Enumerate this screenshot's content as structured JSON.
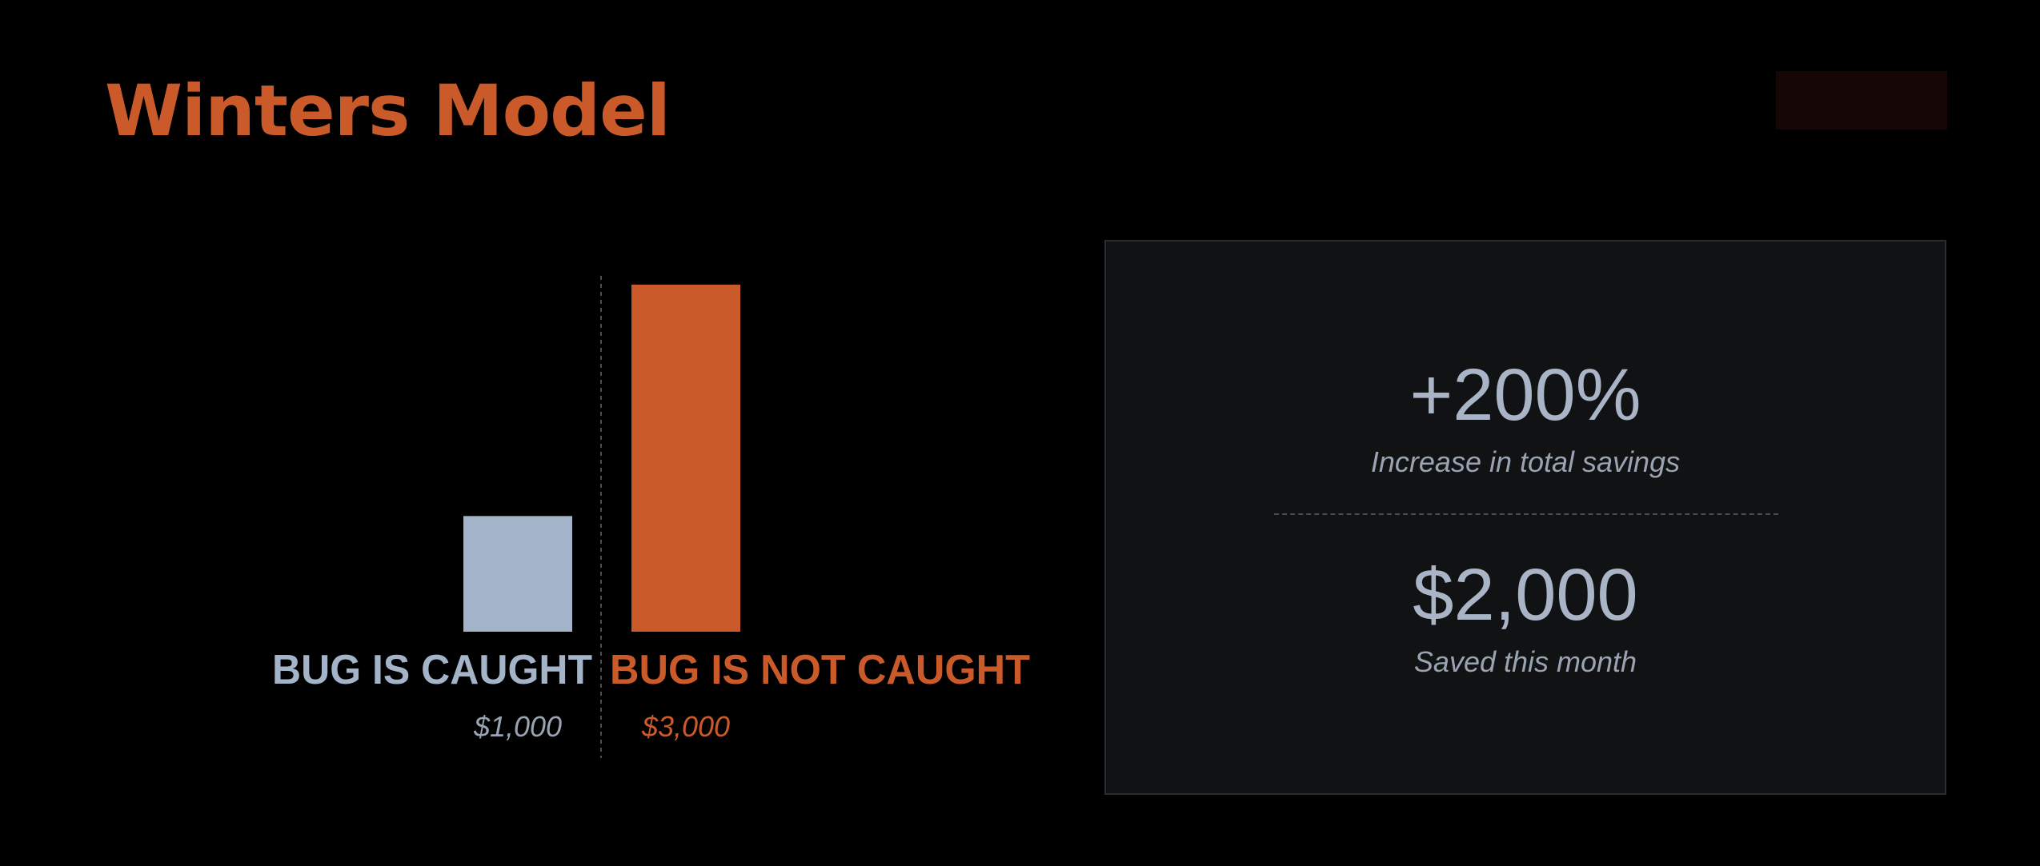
{
  "title": "Winters Model",
  "colors": {
    "background": "#000000",
    "accent": "#cb5a2a",
    "muted": "#a3b3c8",
    "panel": "#111213"
  },
  "chart_data": {
    "type": "bar",
    "title": "",
    "categories": [
      "BUG IS CAUGHT",
      "BUG IS NOT CAUGHT"
    ],
    "values": [
      1000,
      3000
    ],
    "value_labels": [
      "$1,000",
      "$3,000"
    ],
    "colors": [
      "#a3b3c8",
      "#cb5a2a"
    ],
    "xlabel": "",
    "ylabel": "",
    "ylim": [
      0,
      3000
    ],
    "grid": false,
    "legend": "none"
  },
  "stats": [
    {
      "value": "+200%",
      "label": "Increase in total savings"
    },
    {
      "value": "$2,000",
      "label": "Saved this month"
    }
  ]
}
